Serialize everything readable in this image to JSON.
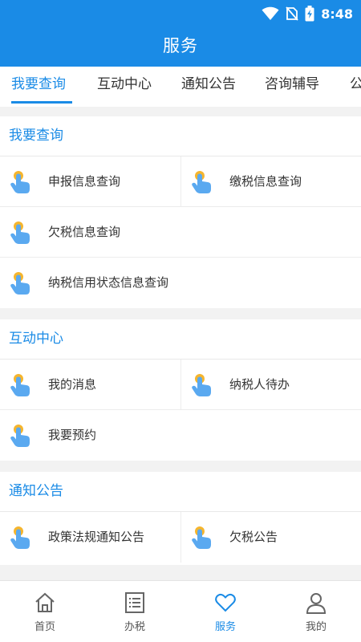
{
  "status_bar": {
    "time": "8:48"
  },
  "app_bar": {
    "title": "服务"
  },
  "tabs": [
    {
      "label": "我要查询",
      "active": true
    },
    {
      "label": "互动中心"
    },
    {
      "label": "通知公告"
    },
    {
      "label": "咨询辅导"
    },
    {
      "label": "公"
    }
  ],
  "sections": [
    {
      "title": "我要查询",
      "items": [
        "申报信息查询",
        "缴税信息查询",
        "欠税信息查询",
        "纳税信用状态信息查询"
      ]
    },
    {
      "title": "互动中心",
      "items": [
        "我的消息",
        "纳税人待办",
        "我要预约"
      ]
    },
    {
      "title": "通知公告",
      "items": [
        "政策法规通知公告",
        "欠税公告"
      ]
    }
  ],
  "bottom_nav": [
    {
      "label": "首页",
      "icon": "home-icon"
    },
    {
      "label": "办税",
      "icon": "list-icon"
    },
    {
      "label": "服务",
      "icon": "heart-icon",
      "active": true
    },
    {
      "label": "我的",
      "icon": "person-icon"
    }
  ],
  "colors": {
    "accent": "#1a8be6",
    "icon_yellow": "#f5b52e",
    "icon_blue": "#5aa9f0"
  }
}
